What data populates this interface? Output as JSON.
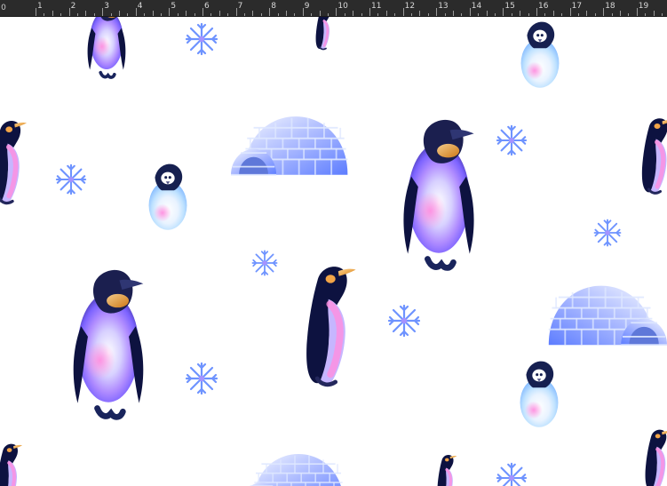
{
  "ruler": {
    "corner": "0",
    "labels": [
      "1",
      "2",
      "3",
      "4",
      "5",
      "6",
      "7",
      "8",
      "9",
      "10",
      "11",
      "12",
      "13",
      "14",
      "15",
      "16",
      "17",
      "18",
      "19"
    ]
  },
  "canvas": {
    "artwork": "penguin-igloo-snowflake-pattern",
    "colors": {
      "background": "#ffffff",
      "ruler": "#2b2b2b",
      "penguin_dark": "#0d1240",
      "penguin_purple": "#8a5bff",
      "penguin_pink": "#ff7ad9",
      "penguin_blue": "#7eb2ff",
      "beak_gold": "#e89a2f",
      "igloo": "#7d9cf2",
      "snowflake": "#6e93ff"
    }
  }
}
